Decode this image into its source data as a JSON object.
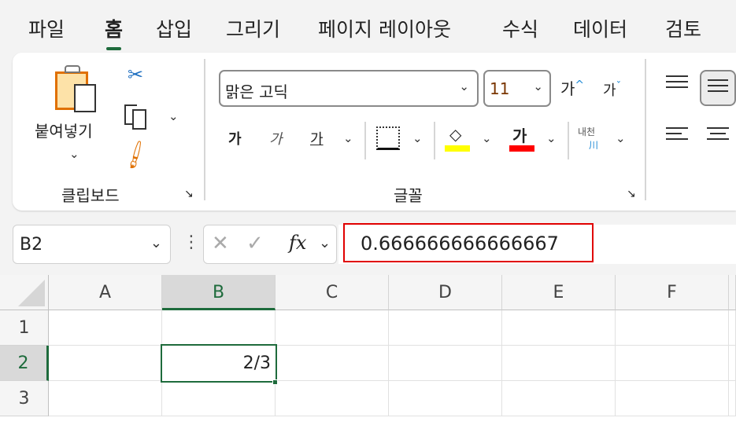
{
  "tabs": [
    "파일",
    "홈",
    "삽입",
    "그리기",
    "페이지 레이아웃",
    "수식",
    "데이터",
    "검토"
  ],
  "active_tab": "홈",
  "clipboard": {
    "paste_label": "붙여넣기",
    "group_label": "클립보드"
  },
  "font": {
    "font_name": "맑은 고딕",
    "font_size": "11",
    "grow_label": "가",
    "shrink_label": "가",
    "bold_label": "가",
    "italic_label": "가",
    "underline_label": "가",
    "font_color_label": "가",
    "phonetic_label": "내천",
    "phonetic_sub": "川",
    "group_label": "글꼴",
    "fill_color": "#ffff00",
    "font_color": "#ff0000"
  },
  "formula_bar": {
    "name_box": "B2",
    "fx": "fx",
    "formula": "0.666666666666667"
  },
  "sheet": {
    "columns": [
      "A",
      "B",
      "C",
      "D",
      "E",
      "F"
    ],
    "rows": [
      "1",
      "2",
      "3"
    ],
    "active_cell": "B2",
    "cells": {
      "B2": "2/3"
    }
  }
}
